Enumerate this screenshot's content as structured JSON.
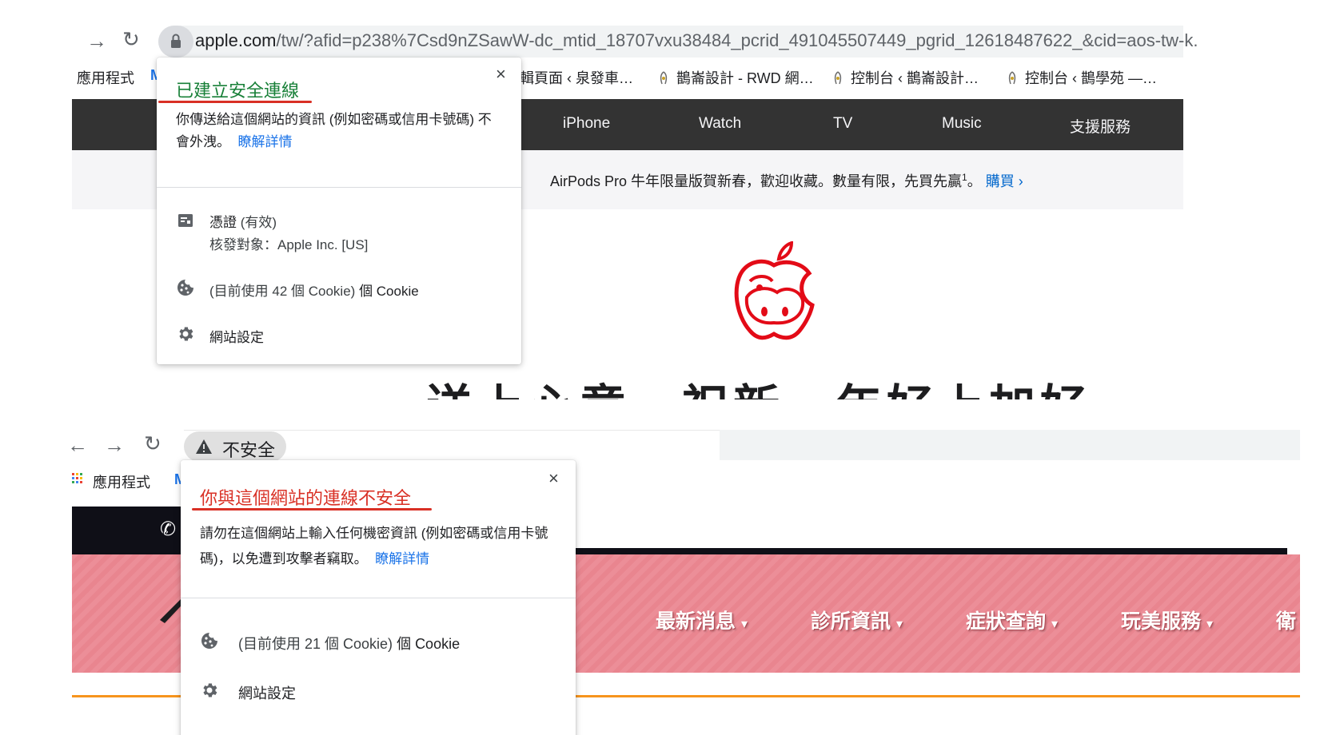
{
  "secure": {
    "url_host": "apple.com",
    "url_rest": "/tw/?afid=p238%7Csd9nZSawW-dc_mtid_18707vxu38484_pcrid_491045507449_pgrid_12618487622_&cid=aos-tw-k.",
    "bookmarks": {
      "apps_label": "應用程式",
      "items": [
        "輯頁面 ‹ 泉發車…",
        "鵲崙設計 - RWD 網…",
        "控制台 ‹ 鵲崙設計…",
        "控制台 ‹ 鵲學苑 —…"
      ]
    },
    "site": {
      "nav": [
        "iPhone",
        "Watch",
        "TV",
        "Music",
        "支援服務"
      ],
      "promo": "AirPods Pro 牛年限量版賀新春，歡迎收藏。數量有限，先買先贏",
      "promo_sup": "1",
      "promo_end": "。",
      "promo_link": "購買 ›",
      "headline": "送上心意，祝新一年好上加好。"
    },
    "popup": {
      "title": "已建立安全連線",
      "description": "你傳送給這個網站的資訊 (例如密碼或信用卡號碼) 不會外洩。",
      "learn_more": "瞭解詳情",
      "cert_title": "憑證",
      "cert_status": "(有效)",
      "cert_issuer": "核發對象：Apple Inc. [US]",
      "cookies_prefix": "(目前使用 42 個 Cookie)",
      "cookies_suffix": "個 Cookie",
      "site_settings": "網站設定",
      "close_glyph": "×"
    }
  },
  "insecure": {
    "badge_text": "不安全",
    "bookmarks": {
      "apps_label": "應用程式"
    },
    "site": {
      "nav": [
        "最新消息",
        "診所資訊",
        "症狀查詢",
        "玩美服務",
        "衛"
      ]
    },
    "popup": {
      "title": "你與這個網站的連線不安全",
      "description": "請勿在這個網站上輸入任何機密資訊 (例如密碼或信用卡號碼)，以免遭到攻擊者竊取。",
      "learn_more": "瞭解詳情",
      "cookies_prefix": "(目前使用 21 個 Cookie)",
      "cookies_suffix": "個 Cookie",
      "site_settings": "網站設定",
      "close_glyph": "×"
    }
  },
  "colors": {
    "secure_green": "#188038",
    "insecure_red": "#d93025",
    "link_blue": "#1a73e8",
    "underline_red": "#d93025"
  }
}
